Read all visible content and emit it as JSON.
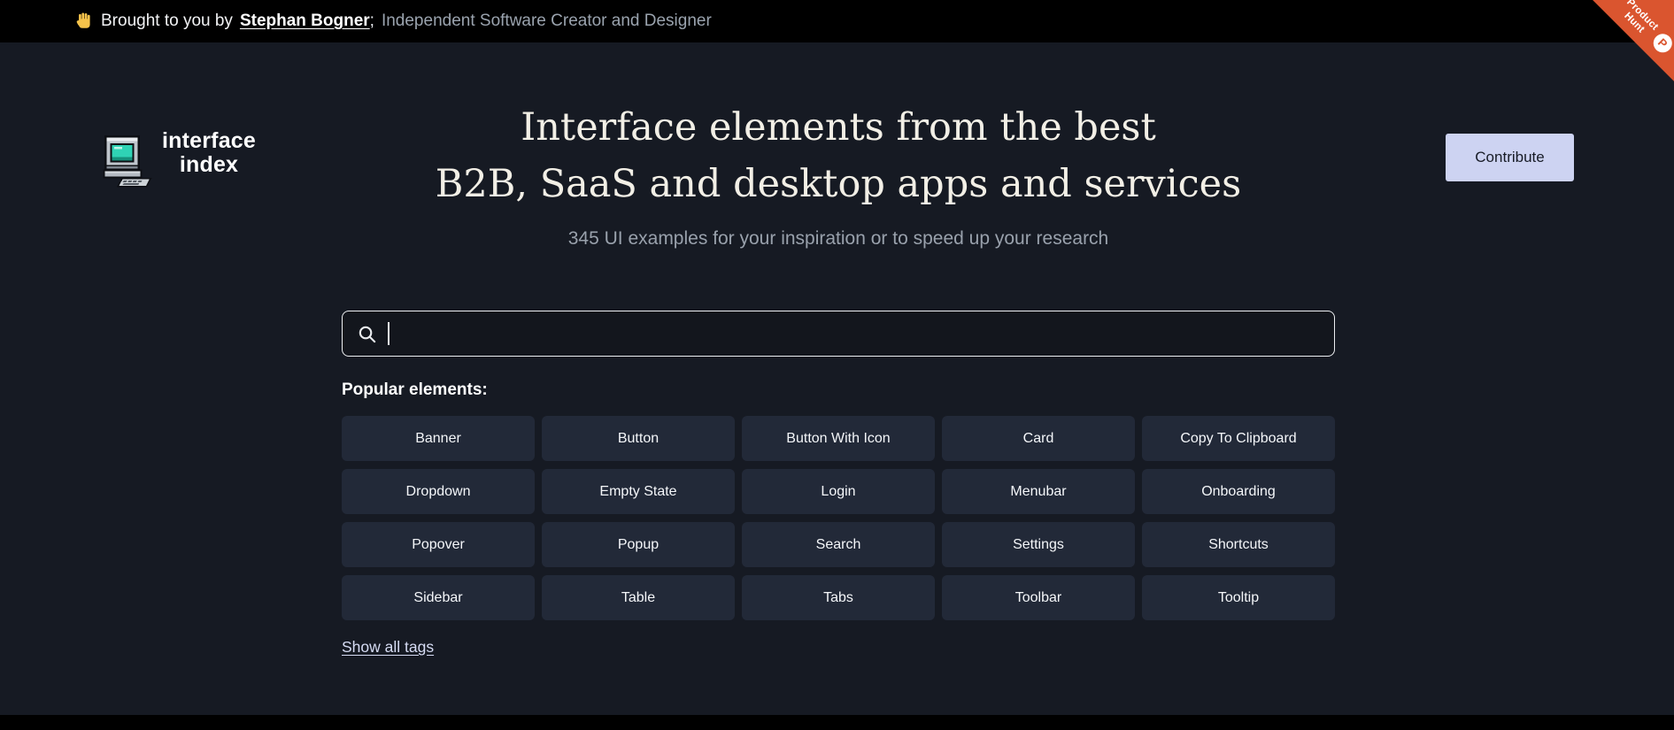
{
  "banner": {
    "wave_icon": "👋",
    "prefix": "Brought to you by",
    "author": "Stephan Bogner",
    "separator": ";",
    "suffix": "Independent Software Creator and Designer"
  },
  "ribbon": {
    "line1": "Product",
    "line2": "Hunt",
    "logo_letter": "P",
    "color": "#da552f"
  },
  "logo": {
    "line1": "interface",
    "line2": "index",
    "icon": "pixel-computer"
  },
  "header": {
    "title_line1": "Interface elements from the best",
    "title_line2": "B2B, SaaS and desktop apps and services",
    "subtitle": "345 UI examples for your inspiration or to speed up your research",
    "contribute_label": "Contribute"
  },
  "search": {
    "value": "",
    "icon": "magnifier"
  },
  "popular": {
    "label": "Popular elements:",
    "tags": [
      "Banner",
      "Button",
      "Button With Icon",
      "Card",
      "Copy To Clipboard",
      "Dropdown",
      "Empty State",
      "Login",
      "Menubar",
      "Onboarding",
      "Popover",
      "Popup",
      "Search",
      "Settings",
      "Shortcuts",
      "Sidebar",
      "Table",
      "Tabs",
      "Toolbar",
      "Tooltip"
    ],
    "show_all_label": "Show all tags"
  },
  "colors": {
    "page_bg": "#161a23",
    "banner_bg": "#000000",
    "tag_bg": "#222938",
    "accent_button": "#cdd3f2",
    "ribbon": "#da552f",
    "screen_teal": "#2fd3b5"
  }
}
